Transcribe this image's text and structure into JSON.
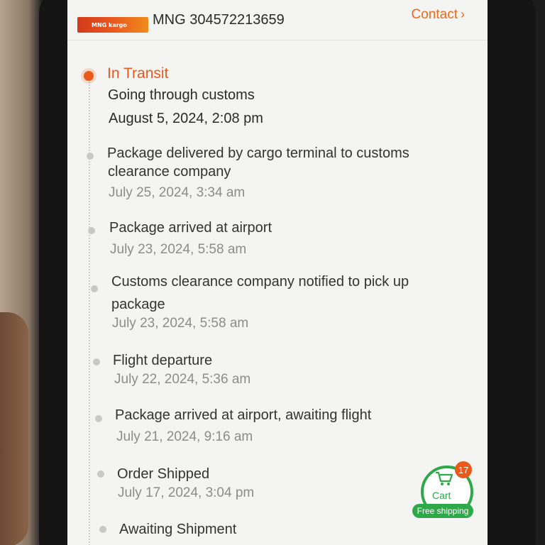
{
  "header": {
    "carrier_logo_text": "MNG kargo",
    "tracking": "MNG 304572213659",
    "contact": "Contact"
  },
  "current": {
    "status": "In Transit",
    "description": "Going through customs",
    "date": "August 5, 2024, 2:08 pm"
  },
  "events": [
    {
      "title_line1": "Package delivered by cargo terminal to customs",
      "title_line2": "clearance company",
      "date": "July 25, 2024, 3:34 am"
    },
    {
      "title_line1": "Package arrived at airport",
      "title_line2": "",
      "date": "July 23, 2024, 5:58 am"
    },
    {
      "title_line1": "Customs clearance company notified to pick up",
      "title_line2": "package",
      "date": "July 23, 2024, 5:58 am"
    },
    {
      "title_line1": "Flight departure",
      "title_line2": "",
      "date": "July 22, 2024, 5:36 am"
    },
    {
      "title_line1": "Package arrived at airport, awaiting flight",
      "title_line2": "",
      "date": "July 21, 2024, 9:16 am"
    },
    {
      "title_line1": "Order Shipped",
      "title_line2": "",
      "date": "July 17, 2024, 3:04 pm"
    },
    {
      "title_line1": "Awaiting Shipment",
      "title_line2": "",
      "date": ""
    }
  ],
  "cart": {
    "label": "Cart",
    "count": "17",
    "free_shipping": "Free shipping",
    "icon": "cart-icon"
  },
  "colors": {
    "accent": "#e8591a",
    "cart_green": "#2fa84a"
  }
}
